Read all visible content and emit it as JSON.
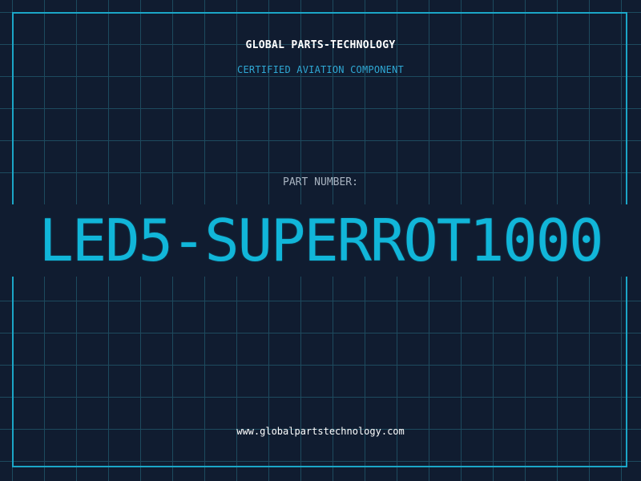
{
  "header": {
    "company": "GLOBAL PARTS-TECHNOLOGY",
    "subtitle": "CERTIFIED AVIATION COMPONENT"
  },
  "part": {
    "label": "PART NUMBER:",
    "number": "LED5-SUPERROT1000"
  },
  "footer": {
    "url": "www.globalpartstechnology.com"
  },
  "colors": {
    "background": "#101c30",
    "grid": "#1d4a5e",
    "border": "#1ba6c7",
    "accent": "#11b6d9"
  }
}
